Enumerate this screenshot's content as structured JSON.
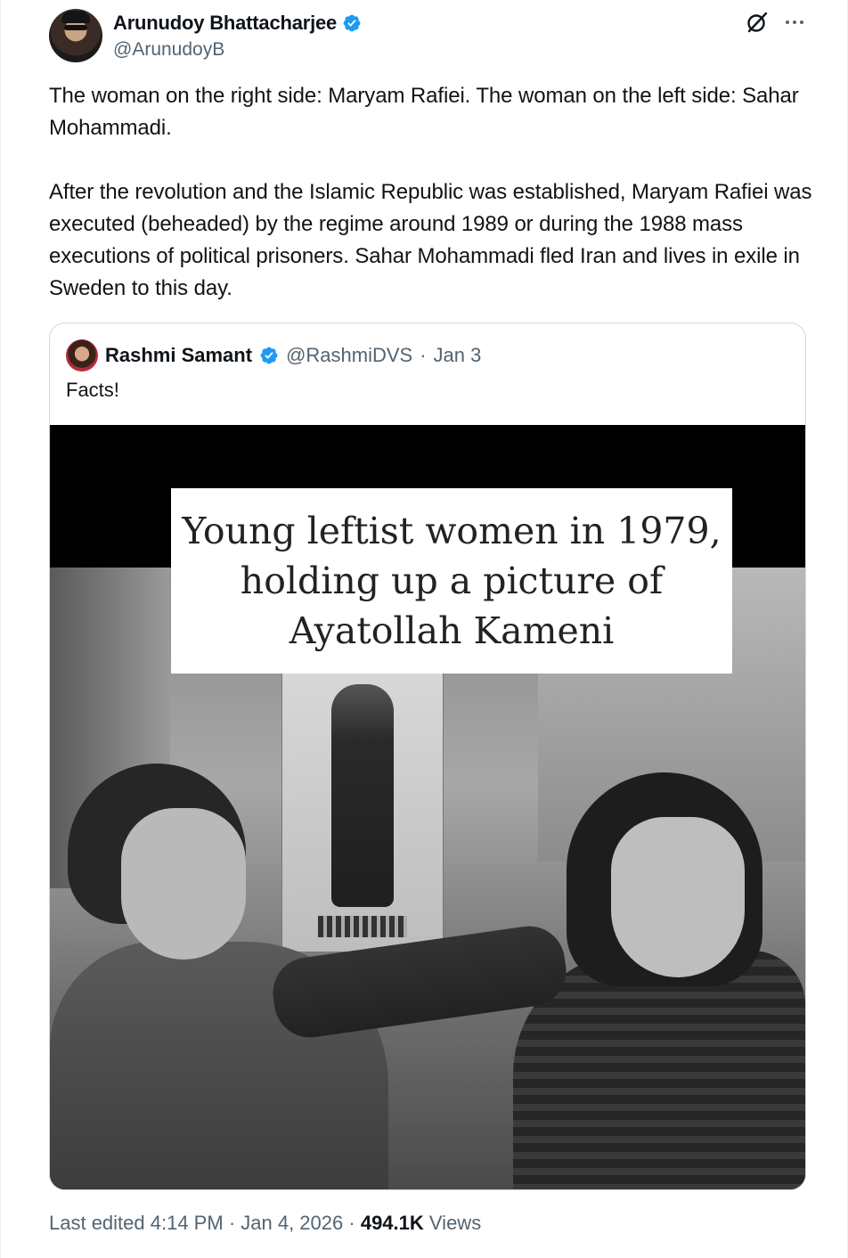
{
  "author": {
    "display_name": "Arunudoy Bhattacharjee",
    "handle": "@ArunudoyB"
  },
  "tweet": {
    "paragraphs": [
      "The woman on the right side: Maryam Rafiei. The woman on the left side: Sahar Mohammadi.",
      "After the revolution and the Islamic Republic was established, Maryam Rafiei was executed (beheaded) by the regime around 1989 or during the 1988 mass executions of political prisoners. Sahar Mohammadi fled Iran and lives in exile in Sweden to this day."
    ]
  },
  "quote": {
    "display_name": "Rashmi Samant",
    "handle": "@RashmiDVS",
    "separator": "·",
    "date": "Jan 3",
    "text": "Facts!",
    "media_caption": "Young leftist women in 1979,\nholding up a picture of\nAyatollah Kameni"
  },
  "footer": {
    "edited": "Last edited 4:14 PM",
    "separator": "·",
    "date": "Jan 4, 2026",
    "views_count": "494.1K",
    "views_label": "Views"
  },
  "colors": {
    "verified": "#1d9bf0",
    "text_primary": "#0f1419",
    "text_secondary": "#536471",
    "border": "#cfd9de"
  },
  "icons": {
    "verified": "verified-badge-icon",
    "grok": "grok-icon",
    "more": "more-horizontal-icon"
  }
}
